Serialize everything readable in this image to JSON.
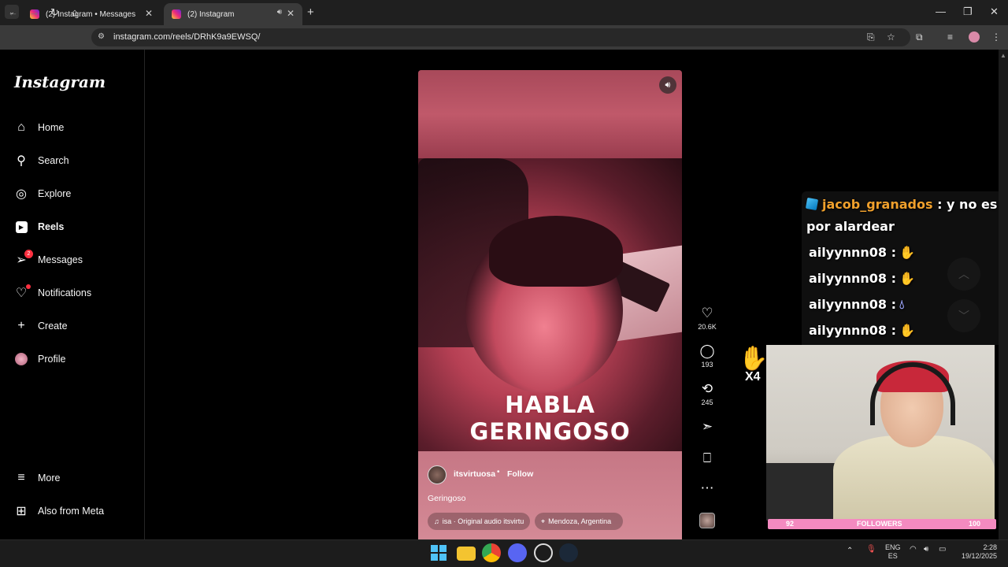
{
  "browser": {
    "tabs": [
      {
        "title": "(2) Instagram • Messages",
        "active": false
      },
      {
        "title": "(2) Instagram",
        "active": true
      }
    ],
    "url": "instagram.com/reels/DRhK9a9EWSQ/"
  },
  "instagram": {
    "logo": "Instagram",
    "nav": [
      {
        "label": "Home",
        "icon": "home-icon"
      },
      {
        "label": "Search",
        "icon": "search-icon"
      },
      {
        "label": "Explore",
        "icon": "explore-icon"
      },
      {
        "label": "Reels",
        "icon": "reels-icon",
        "active": true
      },
      {
        "label": "Messages",
        "icon": "messages-icon",
        "badge": "2"
      },
      {
        "label": "Notifications",
        "icon": "heart-icon",
        "dot": true
      },
      {
        "label": "Create",
        "icon": "plus-icon"
      },
      {
        "label": "Profile",
        "icon": "avatar"
      }
    ],
    "more": "More",
    "meta": "Also from Meta"
  },
  "reel": {
    "overlay_line1": "HABLA",
    "overlay_line2": "GERINGOSO",
    "author": "itsvirtuosa",
    "separator": "•",
    "follow": "Follow",
    "caption": "Geringoso",
    "audio": "isa · Original audio  itsvirtu",
    "location": "Mendoza, Argentina",
    "likes": "20.6K",
    "comments": "193",
    "reposts": "245"
  },
  "stream": {
    "chat": [
      {
        "user": "jacob_granados",
        "text": " : y no es",
        "text2": "por alardear"
      },
      {
        "user": "ailyynnn08",
        "text": " :"
      },
      {
        "user": "ailyynnn08",
        "text": " :"
      },
      {
        "user": "ailyynnn08",
        "text": " :"
      },
      {
        "user": "ailyynnn08",
        "text": " :"
      }
    ],
    "combo": "X4",
    "followers_left": "92",
    "followers_label": "FOLLOWERS",
    "followers_right": "100"
  },
  "taskbar": {
    "lang1": "ENG",
    "lang2": "ES",
    "time": "2:28",
    "date": "19/12/2025"
  }
}
